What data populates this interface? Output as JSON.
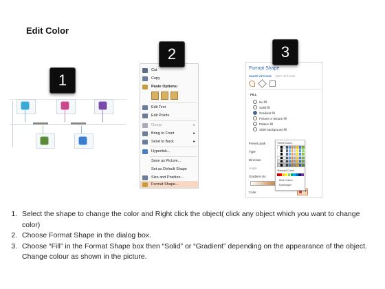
{
  "title": "Edit Color",
  "badges": [
    "1",
    "2",
    "3"
  ],
  "context_menu": {
    "items": [
      {
        "label": "Cut",
        "icon": "scissors-icon",
        "color": "#5a6e8a"
      },
      {
        "label": "Copy",
        "icon": "copy-icon",
        "color": "#6a7e9a"
      },
      {
        "label": "Paste Options:",
        "icon": "paste-icon",
        "color": "#c89b3c"
      },
      {
        "label": "Edit Text",
        "icon": "edit-text-icon",
        "color": "#6a7e9a"
      },
      {
        "label": "Edit Points",
        "icon": "edit-points-icon",
        "color": "#6a7e9a"
      },
      {
        "label": "Group",
        "icon": "group-icon",
        "color": "#9aa"
      },
      {
        "label": "Bring to Front",
        "icon": "bring-front-icon",
        "color": "#6a7e9a"
      },
      {
        "label": "Send to Back",
        "icon": "send-back-icon",
        "color": "#6a7e9a"
      },
      {
        "label": "Hyperlink...",
        "icon": "hyperlink-icon",
        "color": "#4a7ec0"
      },
      {
        "label": "Save as Picture...",
        "icon": "",
        "color": ""
      },
      {
        "label": "Set as Default Shape",
        "icon": "",
        "color": ""
      },
      {
        "label": "Size and Position...",
        "icon": "size-icon",
        "color": "#6a7e9a"
      },
      {
        "label": "Format Shape...",
        "icon": "format-icon",
        "color": "#c89b3c"
      }
    ]
  },
  "format_shape": {
    "title": "Format Shape",
    "tabs": [
      "SHAPE OPTIONS",
      "TEXT OPTIONS"
    ],
    "section": "FILL",
    "fill_options": [
      "No fill",
      "Solid fill",
      "Gradient fill",
      "Picture or texture fill",
      "Pattern fill",
      "Slide background fill"
    ],
    "selected_fill": "Gradient fill",
    "fields": [
      "Preset gradi",
      "Type",
      "Direction",
      "Angle",
      "Gradient sto",
      "Color"
    ],
    "popup": {
      "theme_label": "Theme Colors",
      "standard_label": "Standard Colors",
      "more": "More Colors...",
      "eyedropper": "Eyedropper"
    }
  },
  "instructions": [
    "Select the shape to change the color and Right click the object( click any object which you want to change color)",
    "Choose Format Shape in the dialog box.",
    "Choose “Fill” in the Format Shape box then “Solid” or “Gradient” depending on the appearance of the object. Change colour as shown in the picture."
  ],
  "shape_colors": {
    "cyan": "#3aa9d6",
    "pink": "#c8488a",
    "purple": "#7a4aa8",
    "green": "#5a8a3a",
    "blue": "#3a7ed0"
  }
}
